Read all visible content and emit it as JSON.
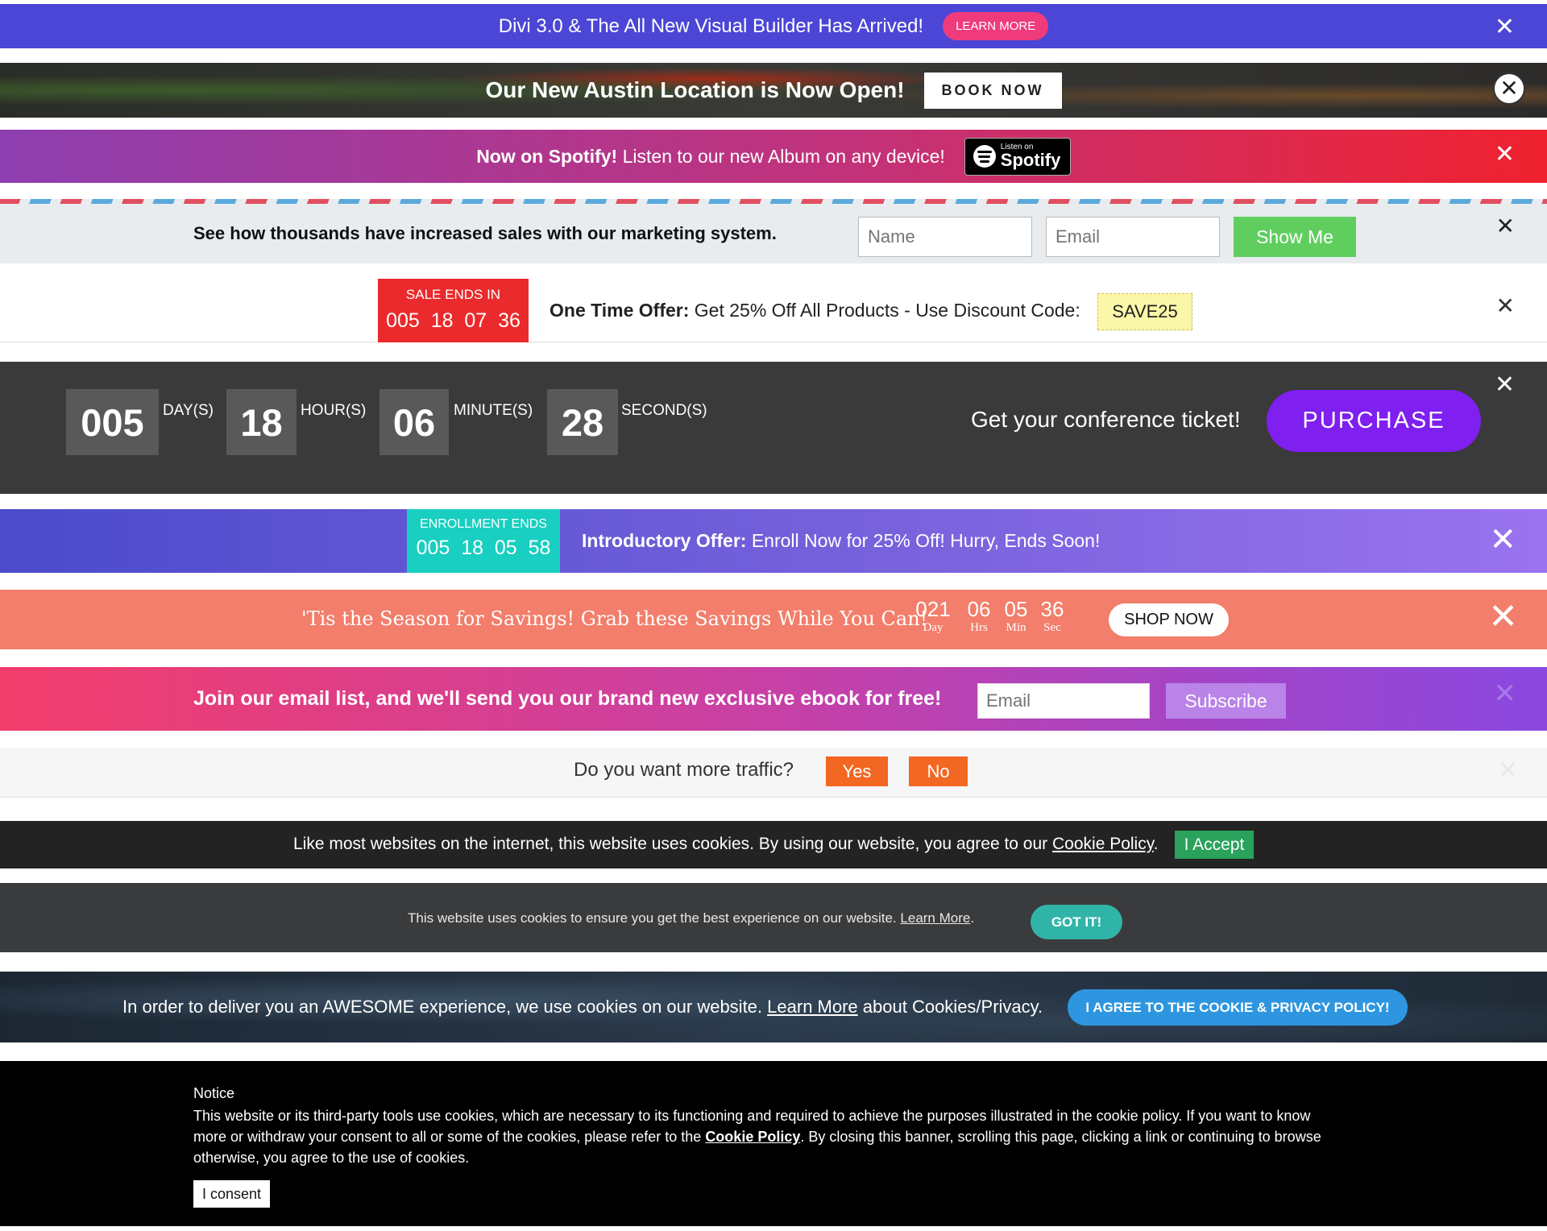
{
  "divi_bar": {
    "message": "Divi 3.0 & The All New Visual Builder Has Arrived!",
    "button": "LEARN MORE",
    "close": "✕",
    "bg_color": "#4b46d6",
    "button_color": "#ef3b7b"
  },
  "austin_bar": {
    "message": "Our New Austin Location is Now Open!",
    "button": "BOOK NOW",
    "close": "✕"
  },
  "spotify_bar": {
    "message_bold": "Now on Spotify!",
    "message": " Listen to our new Album on any device!",
    "badge_small": "Listen on",
    "badge_big": "Spotify",
    "close": "✕"
  },
  "marketing_bar": {
    "message": "See how thousands have increased sales with our marketing system.",
    "name_placeholder": "Name",
    "email_placeholder": "Email",
    "button": "Show Me",
    "close": "✕",
    "button_color": "#5fce5f"
  },
  "offer_bar": {
    "timer_label": "SALE ENDS IN",
    "timer_value": "005  18  07  36",
    "message_bold": "One Time Offer:",
    "message": " Get 25% Off All Products - Use Discount Code:",
    "code": "SAVE25",
    "close": "✕"
  },
  "conference_bar": {
    "units": [
      {
        "value": "005",
        "label": "DAY(S)"
      },
      {
        "value": "18",
        "label": "HOUR(S)"
      },
      {
        "value": "06",
        "label": "MINUTE(S)"
      },
      {
        "value": "28",
        "label": "SECOND(S)"
      }
    ],
    "message": "Get your conference ticket!",
    "button": "PURCHASE",
    "close": "✕",
    "button_color": "#7f1ff0"
  },
  "enroll_bar": {
    "timer_label": "ENROLLMENT ENDS",
    "timer_value": "005  18  05  58",
    "message_bold": "Introductory Offer:",
    "message": " Enroll Now for 25% Off! Hurry, Ends Soon!",
    "close": "✕"
  },
  "season_bar": {
    "message": "'Tis the Season for Savings! Grab these Savings While You Can!",
    "countdown": [
      {
        "value": "021",
        "unit": "Day"
      },
      {
        "value": "06",
        "unit": "Hrs"
      },
      {
        "value": "05",
        "unit": "Min"
      },
      {
        "value": "36",
        "unit": "Sec"
      }
    ],
    "button": "SHOP NOW",
    "close": "✕"
  },
  "email_bar": {
    "message": "Join our email list, and we'll send you our brand new exclusive ebook for free!",
    "email_placeholder": "Email",
    "button": "Subscribe",
    "close": "✕"
  },
  "traffic_bar": {
    "message": "Do you want more traffic?",
    "yes": "Yes",
    "no": "No",
    "close": "✕"
  },
  "cookie_bar_1": {
    "message": "Like most websites on the internet, this website uses cookies. By using our website, you agree to our ",
    "link": "Cookie Policy",
    "suffix": ".",
    "button": "I Accept"
  },
  "cookie_bar_2": {
    "message": "This website uses cookies to ensure you get the best experience on our website. ",
    "link": "Learn More",
    "suffix": ".",
    "button": "GOT IT!"
  },
  "cookie_bar_3": {
    "message": "In order to deliver you an AWESOME experience, we use cookies on our website. ",
    "link": "Learn More",
    "suffix": " about Cookies/Privacy.",
    "button": "I AGREE TO THE COOKIE & PRIVACY POLICY!"
  },
  "notice_bar": {
    "title": "Notice",
    "body_before": "This website or its third-party tools use cookies, which are necessary to its functioning and required to achieve the purposes illustrated in the cookie policy. If you want to know more or withdraw your consent to all or some of the cookies, please refer to the ",
    "link": "Cookie Policy",
    "body_after": ". By closing this banner, scrolling this page, clicking a link or continuing to browse otherwise, you agree to the use of cookies.",
    "button": "I consent"
  }
}
